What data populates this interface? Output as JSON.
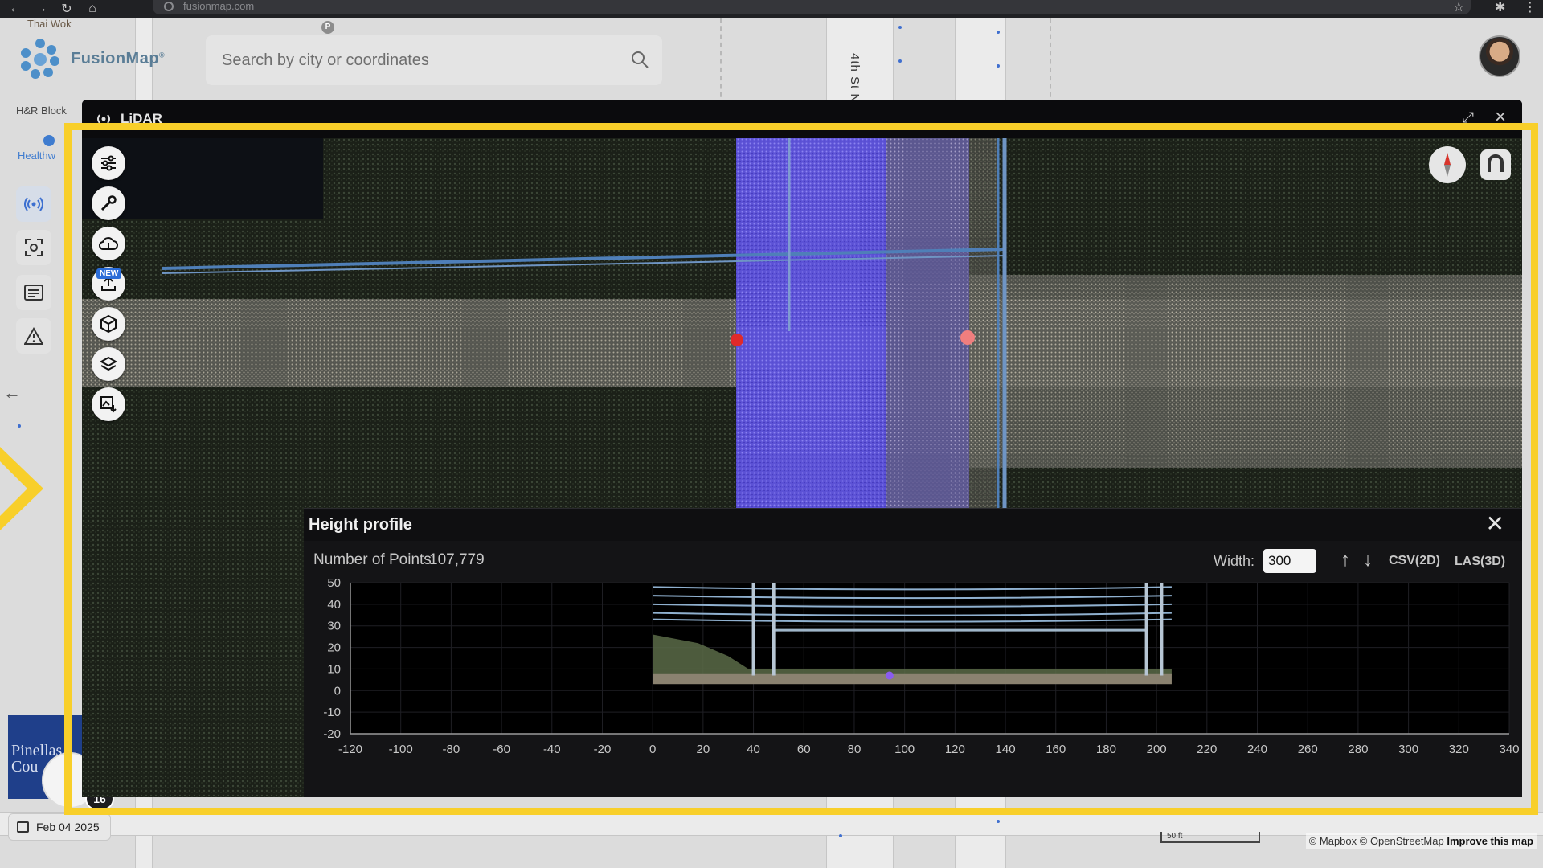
{
  "browser": {
    "url": "fusionmap.com"
  },
  "app": {
    "logo_name": "FusionMap",
    "logo_mark": "®",
    "search_placeholder": "Search by city or coordinates"
  },
  "map": {
    "labels": {
      "thai_wok": "Thai Wok",
      "hr_block": "H&R Block",
      "healthworks": "Healthw",
      "street": "4th St N",
      "poi_p": "P"
    },
    "pinellas": "Pinellas Cou",
    "badge_count": "16",
    "date": "Feb 04 2025",
    "scale": "50 ft",
    "attribution_prefix": "© Mapbox © OpenStreetMap",
    "attribution_link": "Improve this map"
  },
  "lidar": {
    "title": "LiDAR",
    "new_tag": "NEW"
  },
  "height_profile": {
    "title": "Height profile",
    "points_label": "Number of Points:",
    "points_value": "107,779",
    "width_label": "Width:",
    "width_value": "300",
    "csv_label": "CSV(2D)",
    "las_label": "LAS(3D)"
  },
  "chart_data": {
    "type": "scatter",
    "x_ticks": [
      -120,
      -100,
      -80,
      -60,
      -40,
      -20,
      0,
      20,
      40,
      60,
      80,
      100,
      120,
      140,
      160,
      180,
      200,
      220,
      240,
      260,
      280,
      300,
      320,
      340
    ],
    "y_ticks": [
      50,
      40,
      30,
      20,
      10,
      0,
      -10,
      -20
    ],
    "xlim": [
      -120,
      340
    ],
    "ylim": [
      -20,
      50
    ],
    "grid": true,
    "profile_extent_x": [
      0,
      206
    ],
    "wire_heights": [
      48,
      44,
      40,
      36,
      33
    ],
    "pole_positions": [
      40,
      48,
      196,
      202
    ],
    "crossarm_height": 28,
    "ground_height": 7,
    "marker_x": 94,
    "marker_y": 7
  },
  "colors": {
    "accent": "#2a6cd8",
    "highlight": "#f8cf2a",
    "road_overlay": "#6a5cff"
  }
}
